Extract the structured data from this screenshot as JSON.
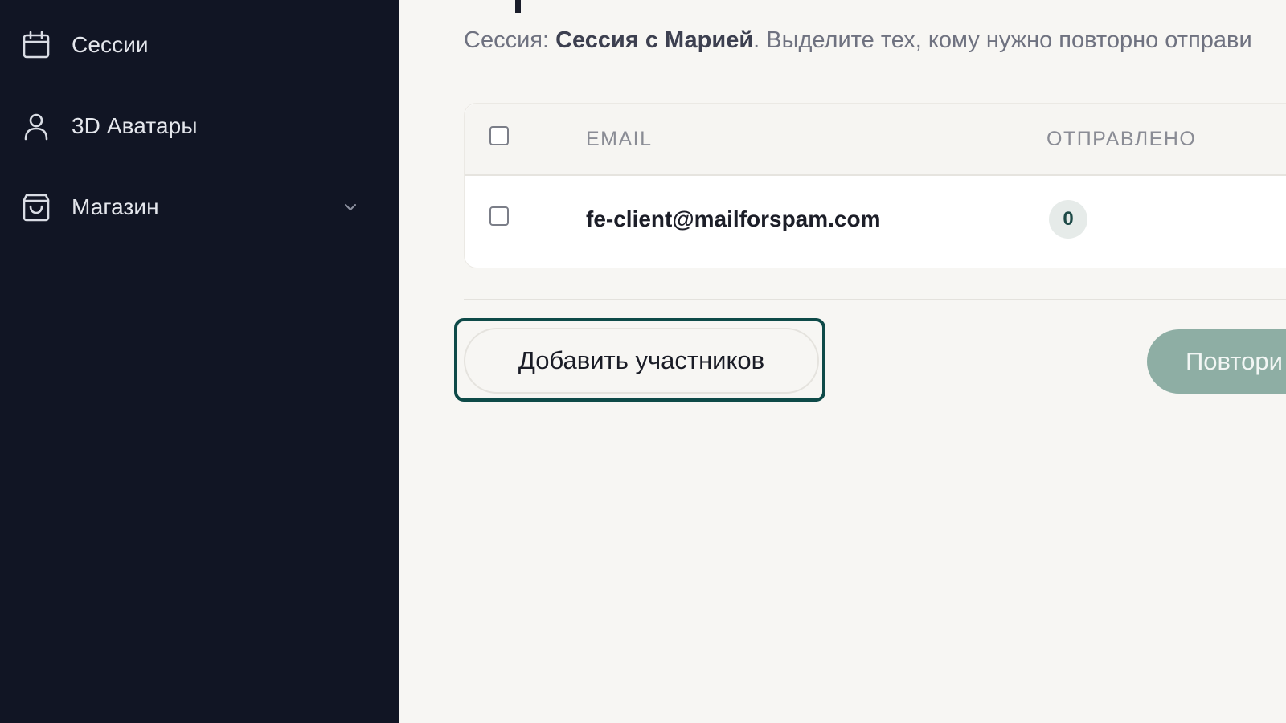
{
  "sidebar": {
    "items": [
      {
        "label": "Сессии",
        "icon": "calendar-icon"
      },
      {
        "label": "3D Аватары",
        "icon": "user-icon"
      },
      {
        "label": "Магазин",
        "icon": "shopping-bag-icon",
        "has_submenu": true
      }
    ]
  },
  "main": {
    "subtitle": {
      "prefix": "Сессия: ",
      "session_name": "Сессия с Марией",
      "suffix": ". Выделите тех, кому нужно повторно отправи"
    },
    "table": {
      "headers": {
        "email": "EMAIL",
        "sent": "ОТПРАВЛЕНО"
      },
      "rows": [
        {
          "email": "fe-client@mailforspam.com",
          "sent": "0"
        }
      ]
    },
    "add_button_label": "Добавить участников",
    "resend_button_label": "Повтори"
  },
  "colors": {
    "sidebar_bg": "#111524",
    "page_bg": "#f7f6f3",
    "accent": "#0e4a48",
    "resend_bg": "#8eaea4"
  }
}
